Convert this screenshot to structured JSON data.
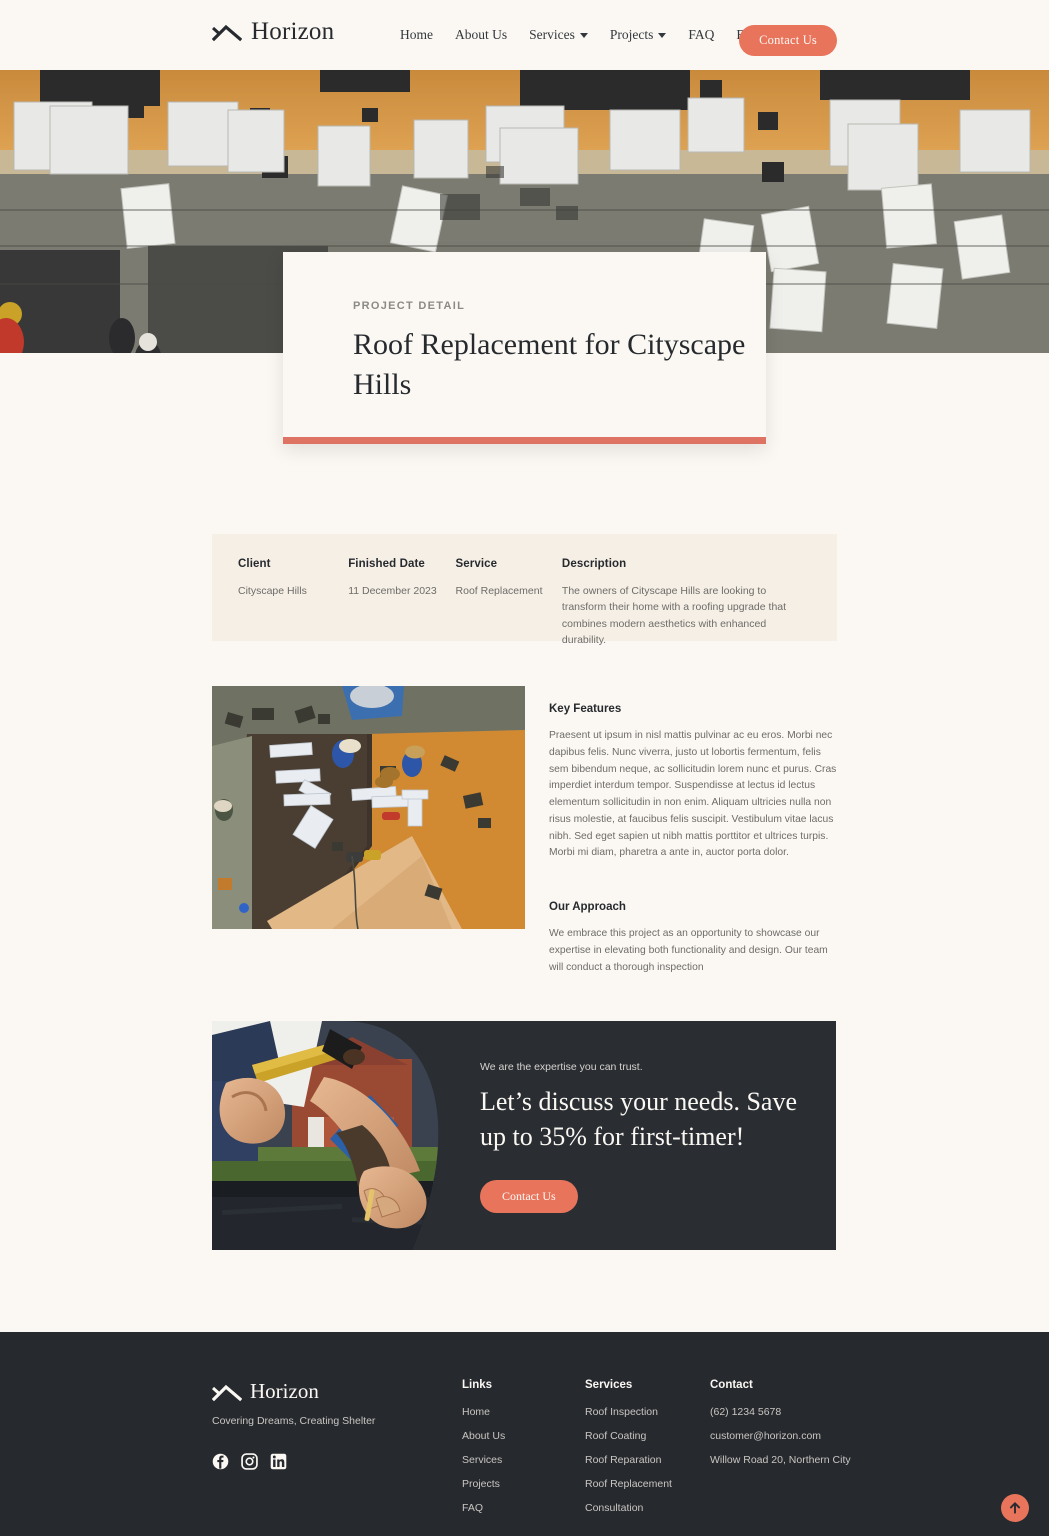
{
  "header": {
    "brand": "Horizon",
    "nav": [
      {
        "label": "Home",
        "caret": false
      },
      {
        "label": "About Us",
        "caret": false
      },
      {
        "label": "Services",
        "caret": true
      },
      {
        "label": "Projects",
        "caret": true
      },
      {
        "label": "FAQ",
        "caret": false
      },
      {
        "label": "Blog",
        "caret": true
      }
    ],
    "cta_label": "Contact Us"
  },
  "hero": {
    "eyebrow": "PROJECT DETAIL",
    "title": "Roof Replacement for Cityscape Hills",
    "accent_color": "#DF7363"
  },
  "info": {
    "client_label": "Client",
    "client_value": "Cityscape Hills",
    "date_label": "Finished Date",
    "date_value": "11 December 2023",
    "service_label": "Service",
    "service_value": "Roof Replacement",
    "description_label": "Description",
    "description_value": "The owners of Cityscape Hills are looking to transform their home with a roofing upgrade that combines modern aesthetics with enhanced durability."
  },
  "details": {
    "features_heading": "Key Features",
    "features_body": "Praesent ut ipsum in nisl mattis pulvinar ac eu eros. Morbi nec dapibus felis. Nunc viverra, justo ut lobortis fermentum, felis sem bibendum neque, ac sollicitudin lorem nunc et purus. Cras imperdiet interdum tempor. Suspendisse at lectus id lectus elementum sollicitudin in non enim. Aliquam ultricies nulla non risus molestie, at faucibus felis suscipit. Vestibulum vitae lacus nibh. Sed eget sapien ut nibh mattis porttitor et ultrices turpis. Morbi mi diam, pharetra a ante in, auctor porta dolor.",
    "approach_heading": "Our Approach",
    "approach_body": "We embrace this project as an opportunity to showcase our expertise in elevating both functionality and design. Our team will conduct a thorough inspection"
  },
  "cta": {
    "eyebrow": "We are the expertise you can trust.",
    "title": "Let’s discuss your needs. Save up to 35% for first-timer!",
    "button_label": "Contact Us",
    "accent_color": "#E8745C"
  },
  "footer": {
    "brand": "Horizon",
    "tagline": "Covering Dreams, Creating Shelter",
    "social": [
      "facebook-icon",
      "instagram-icon",
      "linkedin-icon"
    ],
    "links_heading": "Links",
    "links": [
      "Home",
      "About Us",
      "Services",
      "Projects",
      "FAQ"
    ],
    "services_heading": "Services",
    "services": [
      "Roof Inspection",
      "Roof Coating",
      "Roof Reparation",
      "Roof Replacement",
      "Consultation"
    ],
    "contact_heading": "Contact",
    "contact": [
      "(62) 1234 5678",
      "customer@horizon.com",
      "Willow Road 20, Northern City"
    ],
    "scroll_top_icon": "arrow-up-icon"
  }
}
